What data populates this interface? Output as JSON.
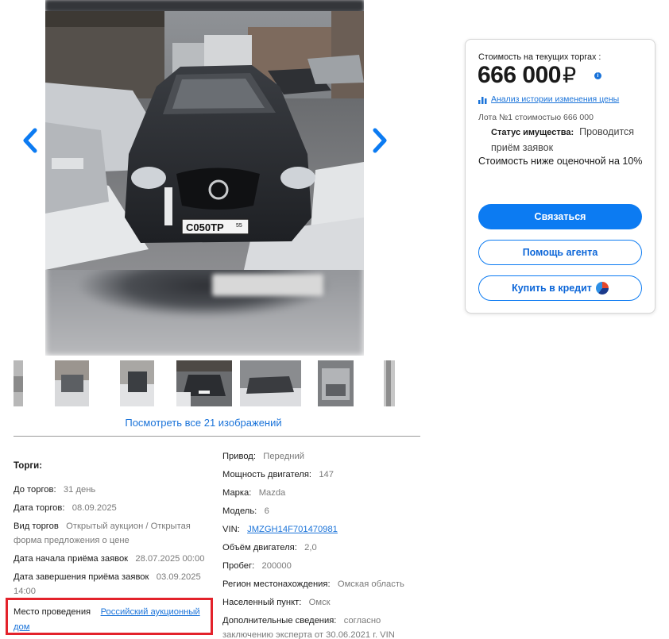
{
  "gallery": {
    "prev_label": "‹",
    "next_label": "›",
    "view_all": "Посмотреть все 21 изображений",
    "plate_text": "С050ТР",
    "plate_region": "55"
  },
  "specs": {
    "section_title": "Торги:",
    "left": [
      {
        "label": "До торгов:",
        "value": "31 день"
      },
      {
        "label": "Дата торгов:",
        "value": "08.09.2025"
      },
      {
        "label": "Вид торгов",
        "value": "Открытый аукцион / Открытая форма предложения о цене"
      },
      {
        "label": "Дата начала приёма заявок",
        "value": "28.07.2025 00:00"
      },
      {
        "label": "Дата завершения приёма заявок",
        "value": "03.09.2025 14:00"
      }
    ],
    "place": {
      "label": "Место проведения",
      "value": "Российский аукционный дом"
    },
    "right": [
      {
        "label": "Привод:",
        "value": "Передний"
      },
      {
        "label": "Мощность двигателя:",
        "value": "147"
      },
      {
        "label": "Марка:",
        "value": "Mazda"
      },
      {
        "label": "Модель:",
        "value": "6"
      },
      {
        "label": "VIN:",
        "value": "JMZGH14F701470981"
      },
      {
        "label": "Объём двигателя:",
        "value": "2,0"
      },
      {
        "label": "Пробег:",
        "value": "200000"
      },
      {
        "label": "Регион местонахождения:",
        "value": "Омская область"
      },
      {
        "label": "Населенный пункт:",
        "value": "Омск"
      },
      {
        "label": "Дополнительные сведения:",
        "value": "согласно заключению эксперта от 30.06.2021 г. VIN"
      }
    ]
  },
  "price_card": {
    "label": "Стоимость на текущих торгах :",
    "price": "666 000",
    "currency": "₽",
    "info_icon": "i",
    "history_link": "Анализ истории изменения цены",
    "lot": "Лота №1 стоимостью 666 000",
    "status_label": "Статус имущества:",
    "status_value": "Проводится приём заявок",
    "below_estimate": "Стоимость ниже оценочной на 10%",
    "contact_button": "Связаться",
    "agent_button": "Помощь агента",
    "credit_button": "Купить в кредит"
  },
  "colors": {
    "accent": "#0c7bf2",
    "link": "#1a73d9",
    "highlight_border": "#e3222b"
  },
  "icons": [
    "chevron-left-icon",
    "chevron-right-icon",
    "info-icon",
    "bar-chart-icon",
    "bank-logo-icon"
  ]
}
